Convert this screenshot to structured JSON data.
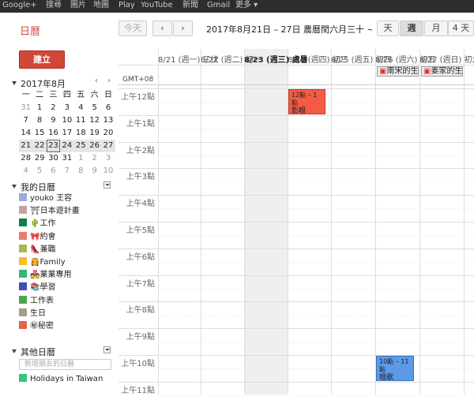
{
  "topbar": [
    "Google+",
    "搜尋",
    "圖片",
    "地圖",
    "Play",
    "YouTube",
    "新聞",
    "Gmail",
    "更多 ▾"
  ],
  "header": {
    "app_title": "日曆",
    "today": "今天",
    "prev": "‹",
    "next": "›",
    "date_range": "2017年8月21日 – 27日 農曆閏六月三十 ~",
    "views": {
      "day": "天",
      "week": "週",
      "month": "月",
      "four_day": "4 天"
    }
  },
  "sidebar": {
    "create": "建立",
    "mini_title": "2017年8月",
    "mini_prev": "‹",
    "mini_next": "›",
    "weekday_headers": [
      "一",
      "二",
      "三",
      "四",
      "五",
      "六",
      "日"
    ],
    "weeks": [
      [
        "31",
        "1",
        "2",
        "3",
        "4",
        "5",
        "6"
      ],
      [
        "7",
        "8",
        "9",
        "10",
        "11",
        "12",
        "13"
      ],
      [
        "14",
        "15",
        "16",
        "17",
        "18",
        "19",
        "20"
      ],
      [
        "21",
        "22",
        "23",
        "24",
        "25",
        "26",
        "27"
      ],
      [
        "28",
        "29",
        "30",
        "31",
        "1",
        "2",
        "3"
      ],
      [
        "4",
        "5",
        "6",
        "7",
        "8",
        "9",
        "10"
      ]
    ],
    "my_cal_title": "我的日曆",
    "my_calendars": [
      {
        "name": "youko 王容",
        "color": "#9fa8da"
      },
      {
        "name": "⛩日本遊計畫",
        "color": "#c2a3a3"
      },
      {
        "name": "🌵工作",
        "color": "#0b8043"
      },
      {
        "name": "🎀約會",
        "color": "#e67c73"
      },
      {
        "name": "👠兼職",
        "color": "#a4bd4a"
      },
      {
        "name": "👸Family",
        "color": "#f6bf26"
      },
      {
        "name": "💑業業專用",
        "color": "#33b679"
      },
      {
        "name": "📚學習",
        "color": "#3f51b5"
      },
      {
        "name": "工作表",
        "color": "#4fa64f"
      },
      {
        "name": "生日",
        "color": "#a79b8e"
      },
      {
        "name": "㊙秘密",
        "color": "#e8604c"
      }
    ],
    "other_cal_title": "其他日曆",
    "add_friend_placeholder": "新增朋友的日曆",
    "other_calendars": [
      {
        "name": "Holidays in Taiwan",
        "color": "#2fc77c"
      }
    ]
  },
  "grid": {
    "gmt": "GMT+08",
    "days": [
      "8/21 (週一) 三伏",
      "8/22 (週二) 初一",
      "8/23 (週三) 處暑",
      "8/24 (週四) 初三",
      "8/25 (週五) 初四",
      "8/26 (週六) 初五",
      "8/27 (週日) 初六"
    ],
    "hours": [
      "上午12點",
      "上午1點",
      "上午2點",
      "上午3點",
      "上午4點",
      "上午5點",
      "上午6點",
      "上午7點",
      "上午8點",
      "上午9點",
      "上午10點",
      "上午11點"
    ],
    "allday_events": [
      {
        "day": 5,
        "label": "南宋的生"
      },
      {
        "day": 6,
        "label": "姜家的生"
      }
    ],
    "events": [
      {
        "day": 3,
        "time": "12點 – 1點",
        "title": "影眼",
        "color": "#f35b47",
        "border": "#c23b27"
      },
      {
        "day": 5,
        "time": "10點 – 11點",
        "title": "唱歌",
        "color": "#5c9ae6",
        "border": "#3b6fbf"
      }
    ]
  },
  "colors": {
    "accent": "#dd4b39",
    "create_button": "#d14836",
    "current_day_bg": "#efefef"
  }
}
